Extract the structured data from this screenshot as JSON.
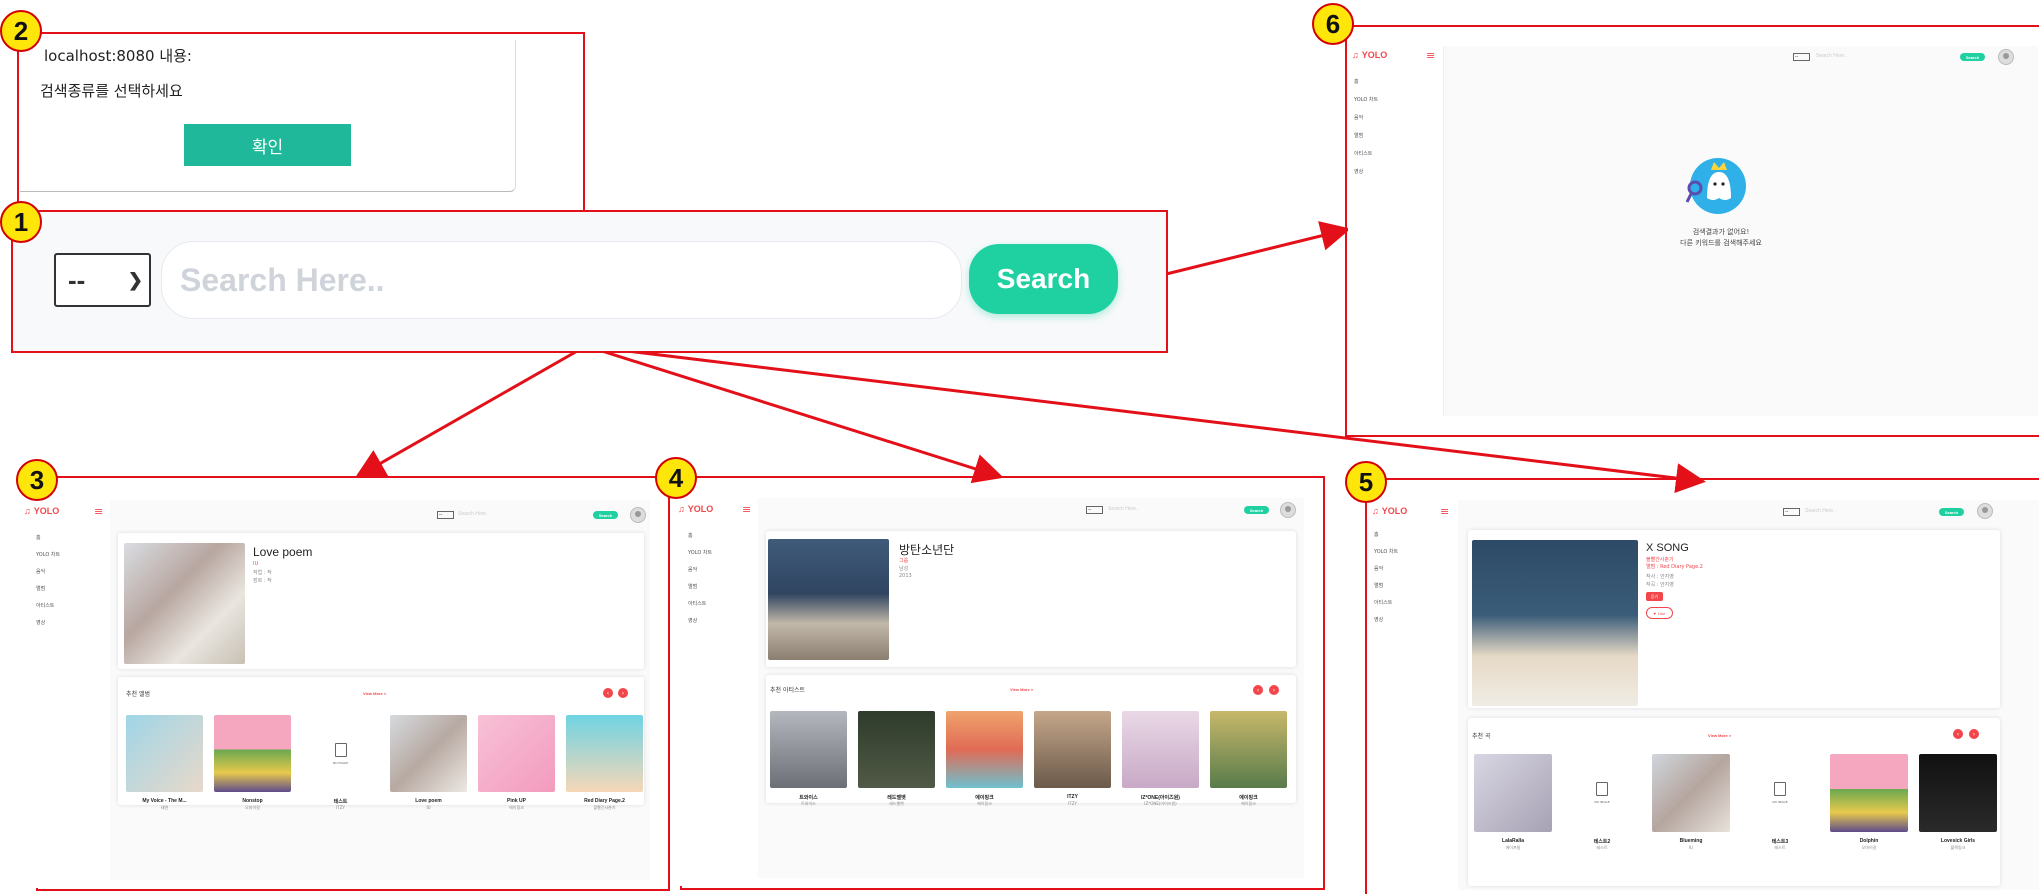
{
  "badges": [
    "1",
    "2",
    "3",
    "4",
    "5",
    "6"
  ],
  "alert": {
    "host": "localhost:8080 내용:",
    "message": "검색종류를 선택하세요",
    "ok_label": "확인"
  },
  "search": {
    "select_value": "--",
    "placeholder": "Search Here..",
    "button_label": "Search"
  },
  "app": {
    "logo_text": "YOLO",
    "sidebar": [
      "홈",
      "YOLO 차트",
      "음악",
      "앨범",
      "아티스트",
      "영상"
    ],
    "top_select": "--",
    "top_placeholder": "Search Here..",
    "top_button": "Search",
    "view_more": "View More >"
  },
  "screen3": {
    "album_title": "Love poem",
    "artist": "IU",
    "meta1": "작업 : 작",
    "meta2": "장르 : 작",
    "section_title": "추천 앨범",
    "items": [
      {
        "name": "My Voice - The M...",
        "sub": "태연"
      },
      {
        "name": "Nonstop",
        "sub": "오마이걸"
      },
      {
        "name": "테스트",
        "sub": "ITZY",
        "noimg": true
      },
      {
        "name": "Love poem",
        "sub": "IU"
      },
      {
        "name": "Pink UP",
        "sub": "에이핑크"
      },
      {
        "name": "Red Diary Page.2",
        "sub": "볼빨간사춘기"
      }
    ],
    "noimg_label": "NO IMAGE"
  },
  "screen4": {
    "artist_title": "방탄소년단",
    "type": "그룹",
    "meta1": "남성",
    "meta2": "2013",
    "section_title": "추천 아티스트",
    "items": [
      {
        "name": "트와이스",
        "sub": "트와이스"
      },
      {
        "name": "레드벨벳",
        "sub": "레드벨벳"
      },
      {
        "name": "에이핑크",
        "sub": "에이핑크"
      },
      {
        "name": "ITZY",
        "sub": "ITZY"
      },
      {
        "name": "IZ*ONE(아이즈원)",
        "sub": "IZ*ONE(아이즈원)"
      },
      {
        "name": "에이핑크",
        "sub": "에이핑크"
      }
    ]
  },
  "screen5": {
    "song_title": "X SONG",
    "artist": "볼빨간사춘기",
    "album_line": "앨범 : Red Diary Page.2",
    "meta1": "작사 : 안지영",
    "meta2": "작곡 : 안지영",
    "play_label": "듣기",
    "like_label": "Like",
    "section_title": "추천 곡",
    "items": [
      {
        "name": "LalaRalla",
        "sub": "에이프릴"
      },
      {
        "name": "테스트2",
        "sub": "테스트",
        "noimg": true
      },
      {
        "name": "Blueming",
        "sub": "IU"
      },
      {
        "name": "테스트3",
        "sub": "테스트",
        "noimg": true
      },
      {
        "name": "Dolphin",
        "sub": "오마이걸"
      },
      {
        "name": "Lovesick Girls",
        "sub": "블랙핑크"
      }
    ],
    "noimg_label": "NO IMAGE"
  },
  "screen6": {
    "empty_line1": "검색결과가 없어요!",
    "empty_line2": "다른 키워드를 검색해주세요"
  },
  "colors": {
    "annotation_red": "#e3101a",
    "accent_green": "#1fd1a1",
    "brand_red": "#f2464b",
    "ok_teal": "#1fb89a"
  }
}
